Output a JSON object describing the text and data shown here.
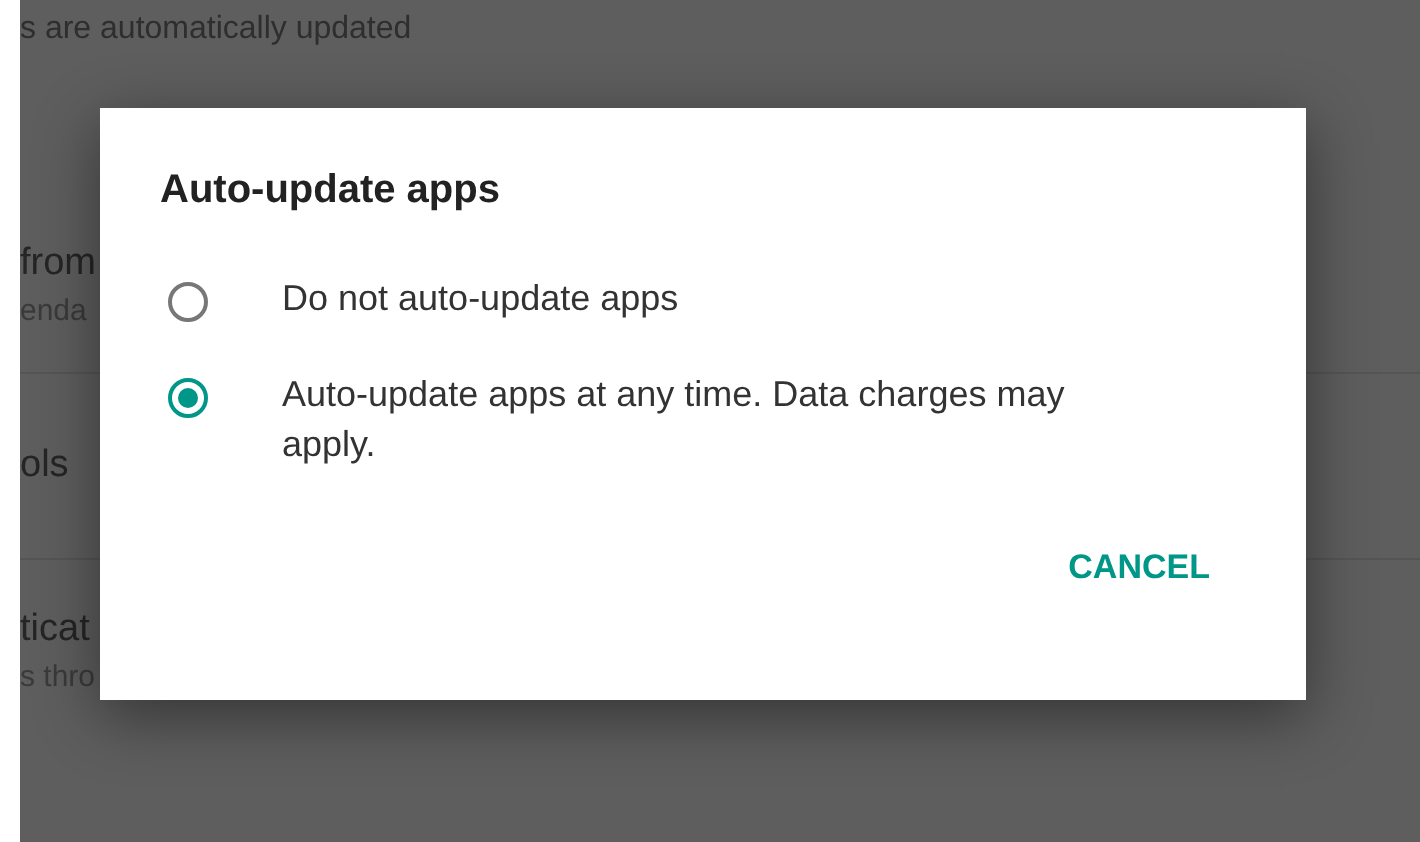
{
  "background": {
    "header_text": "s are automatically updated",
    "items": [
      {
        "title": "from",
        "subtitle": "enda"
      },
      {
        "title": "ols"
      },
      {
        "title": "ticat",
        "subtitle": "s thro"
      }
    ]
  },
  "dialog": {
    "title": "Auto-update apps",
    "options": [
      {
        "label": "Do not auto-update apps",
        "selected": false
      },
      {
        "label": "Auto-update apps at any time. Data charges may apply.",
        "selected": true
      }
    ],
    "buttons": [
      {
        "label": "CANCEL"
      }
    ]
  }
}
